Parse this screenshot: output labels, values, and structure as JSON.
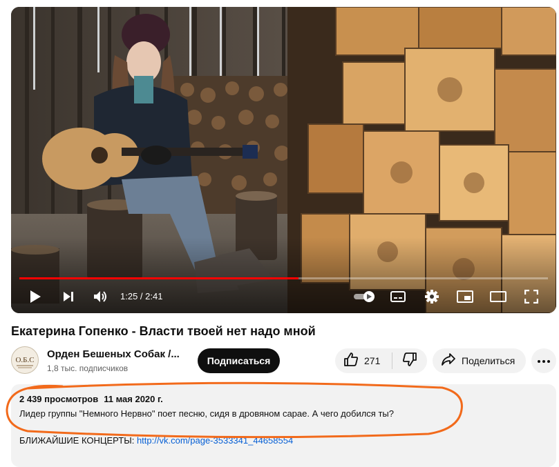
{
  "player": {
    "current_time": "1:25",
    "duration": "2:41",
    "time_separator": " / ",
    "progress_fraction": 0.528
  },
  "video": {
    "title": "Екатерина Гопенко - Власти твоей нет надо мной"
  },
  "channel": {
    "name": "Орден Бешеных Собак /...",
    "subscribers": "1,8 тыс. подписчиков",
    "avatar_text": "О.Б.С"
  },
  "actions": {
    "subscribe_label": "Подписаться",
    "like_count": "271",
    "share_label": "Поделиться"
  },
  "description": {
    "views": "2 439 просмотров",
    "date": "11 мая 2020 г.",
    "text": "Лидер группы \"Немного Нервно\" поет песню, сидя в дровяном сарае. А чего добился ты?",
    "concerts_label": "БЛИЖАЙШИЕ КОНЦЕРТЫ: ",
    "concerts_link": "http://vk.com/page-3533341_44658554"
  },
  "colors": {
    "progress": "#ff0000",
    "annotation": "#f26a1b",
    "link": "#065fd4",
    "subscribe_bg": "#0f0f0f"
  },
  "icons": {
    "play": "play-icon",
    "next": "next-icon",
    "volume": "volume-icon",
    "autoplay": "autoplay-toggle-icon",
    "subtitles": "subtitles-icon",
    "settings": "gear-icon",
    "miniplayer": "miniplayer-icon",
    "theater": "theater-mode-icon",
    "fullscreen": "fullscreen-icon",
    "like": "thumbs-up-icon",
    "dislike": "thumbs-down-icon",
    "share": "share-arrow-icon",
    "more": "more-dots-icon"
  }
}
